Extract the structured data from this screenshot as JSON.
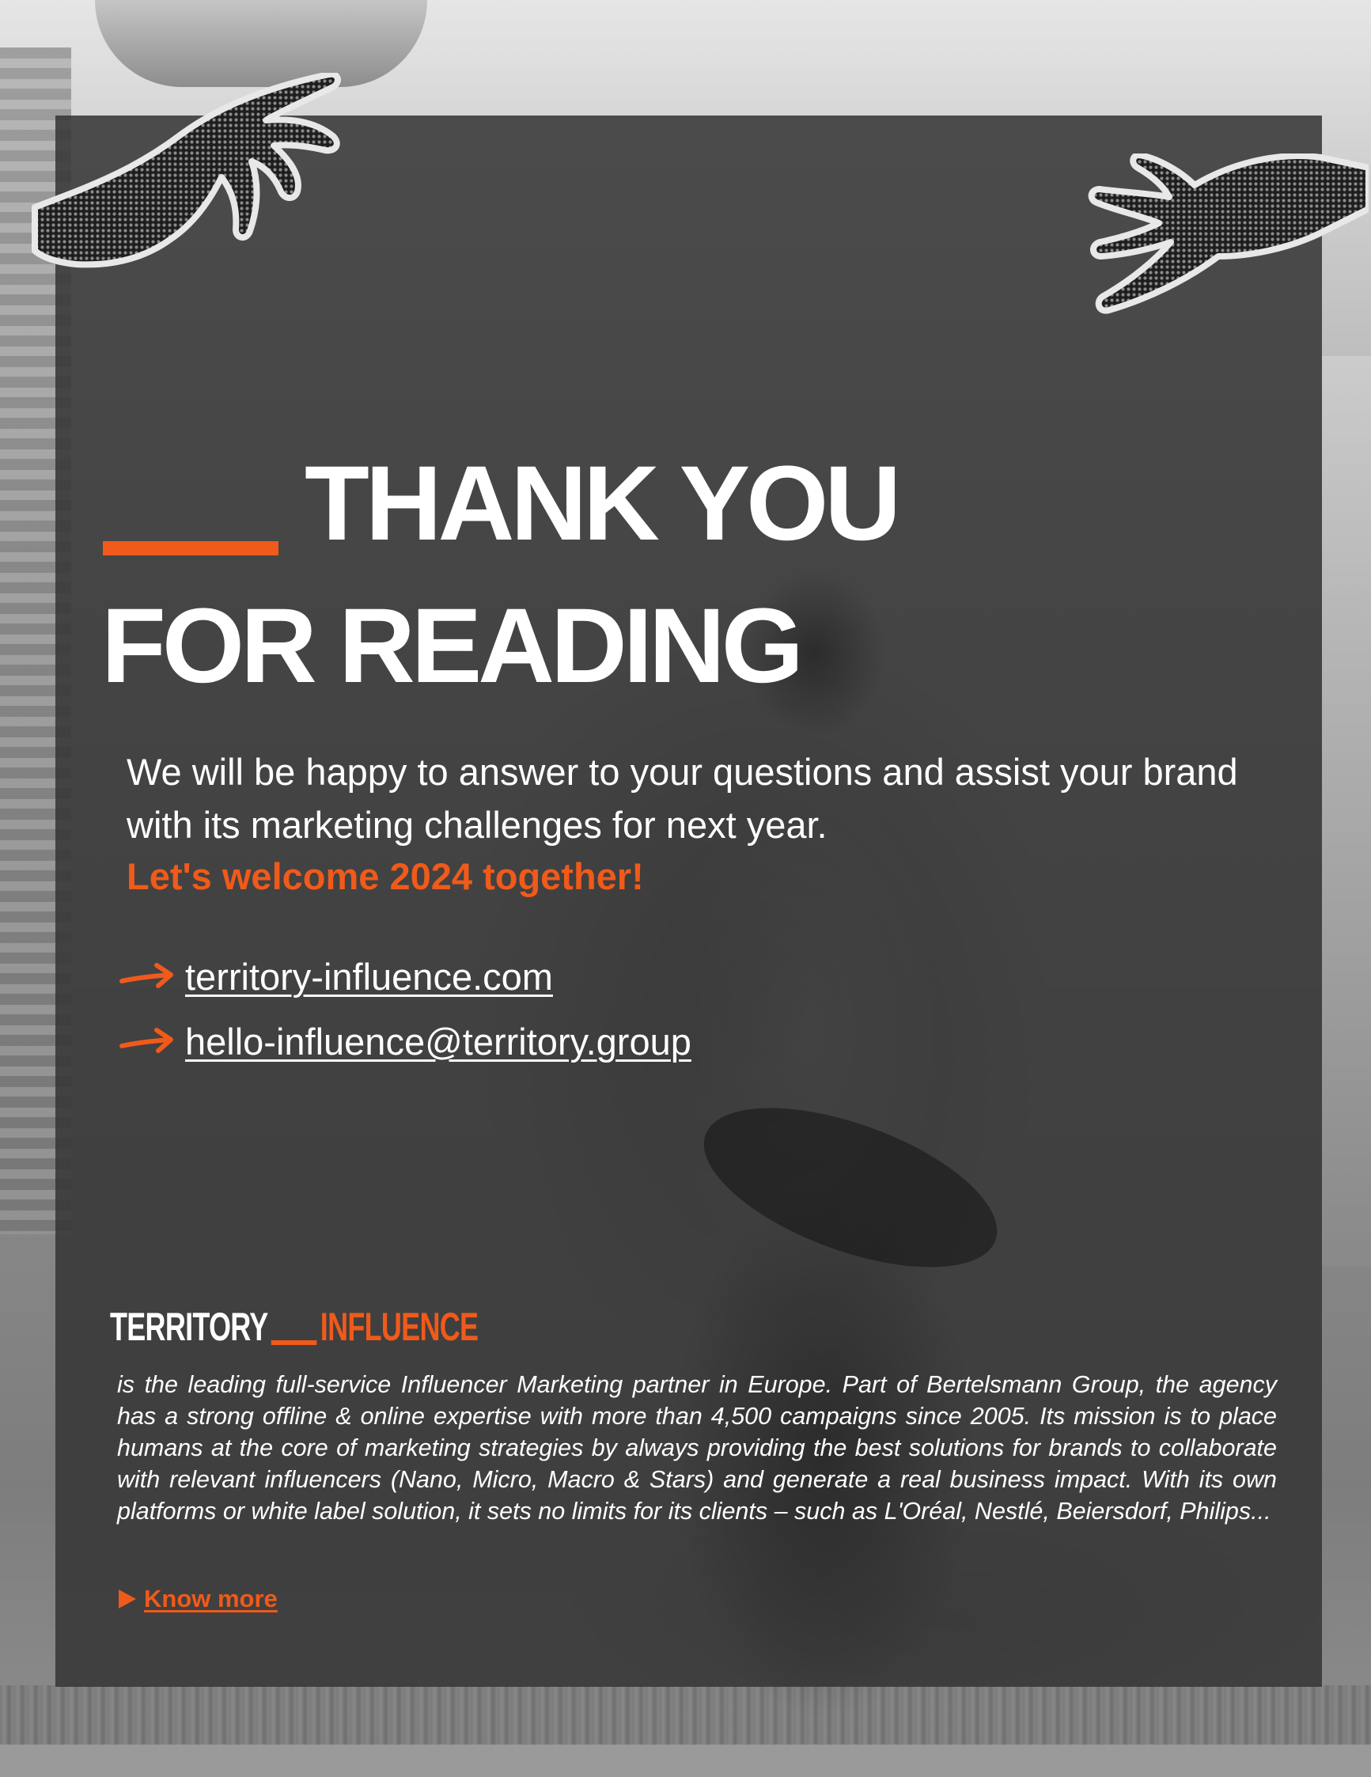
{
  "headline": {
    "line1": "THANK YOU",
    "line2": "FOR READING"
  },
  "intro": {
    "text": "We will be happy to answer to your questions and assist your brand with its marketing challenges for next year.",
    "cta": "Let's welcome 2024 together!"
  },
  "contacts": [
    {
      "label": "territory-influence.com",
      "icon": "arrow-right-icon"
    },
    {
      "label": "hello-influence@territory.group",
      "icon": "arrow-right-icon"
    }
  ],
  "logo": {
    "left": "TERRITORY",
    "right": "INFLUENCE"
  },
  "description": "is the leading full-service Influencer Marketing partner in Europe. Part of Bertelsmann Group, the agency has a strong offline & online expertise with more than 4,500 campaigns since 2005. Its mission is to place humans at the core of marketing strategies by always providing the best solutions for brands to collaborate with relevant influencers (Nano, Micro, Macro & Stars) and generate a real business impact. With its own platforms or white label solution, it sets no limits for its clients – such as L'Oréal, Nestlé, Beiersdorf, Philips...",
  "know_more": {
    "label": "Know more",
    "icon": "play-triangle-icon"
  },
  "colors": {
    "accent": "#f05a1a",
    "panel": "#343434",
    "text": "#ffffff"
  }
}
